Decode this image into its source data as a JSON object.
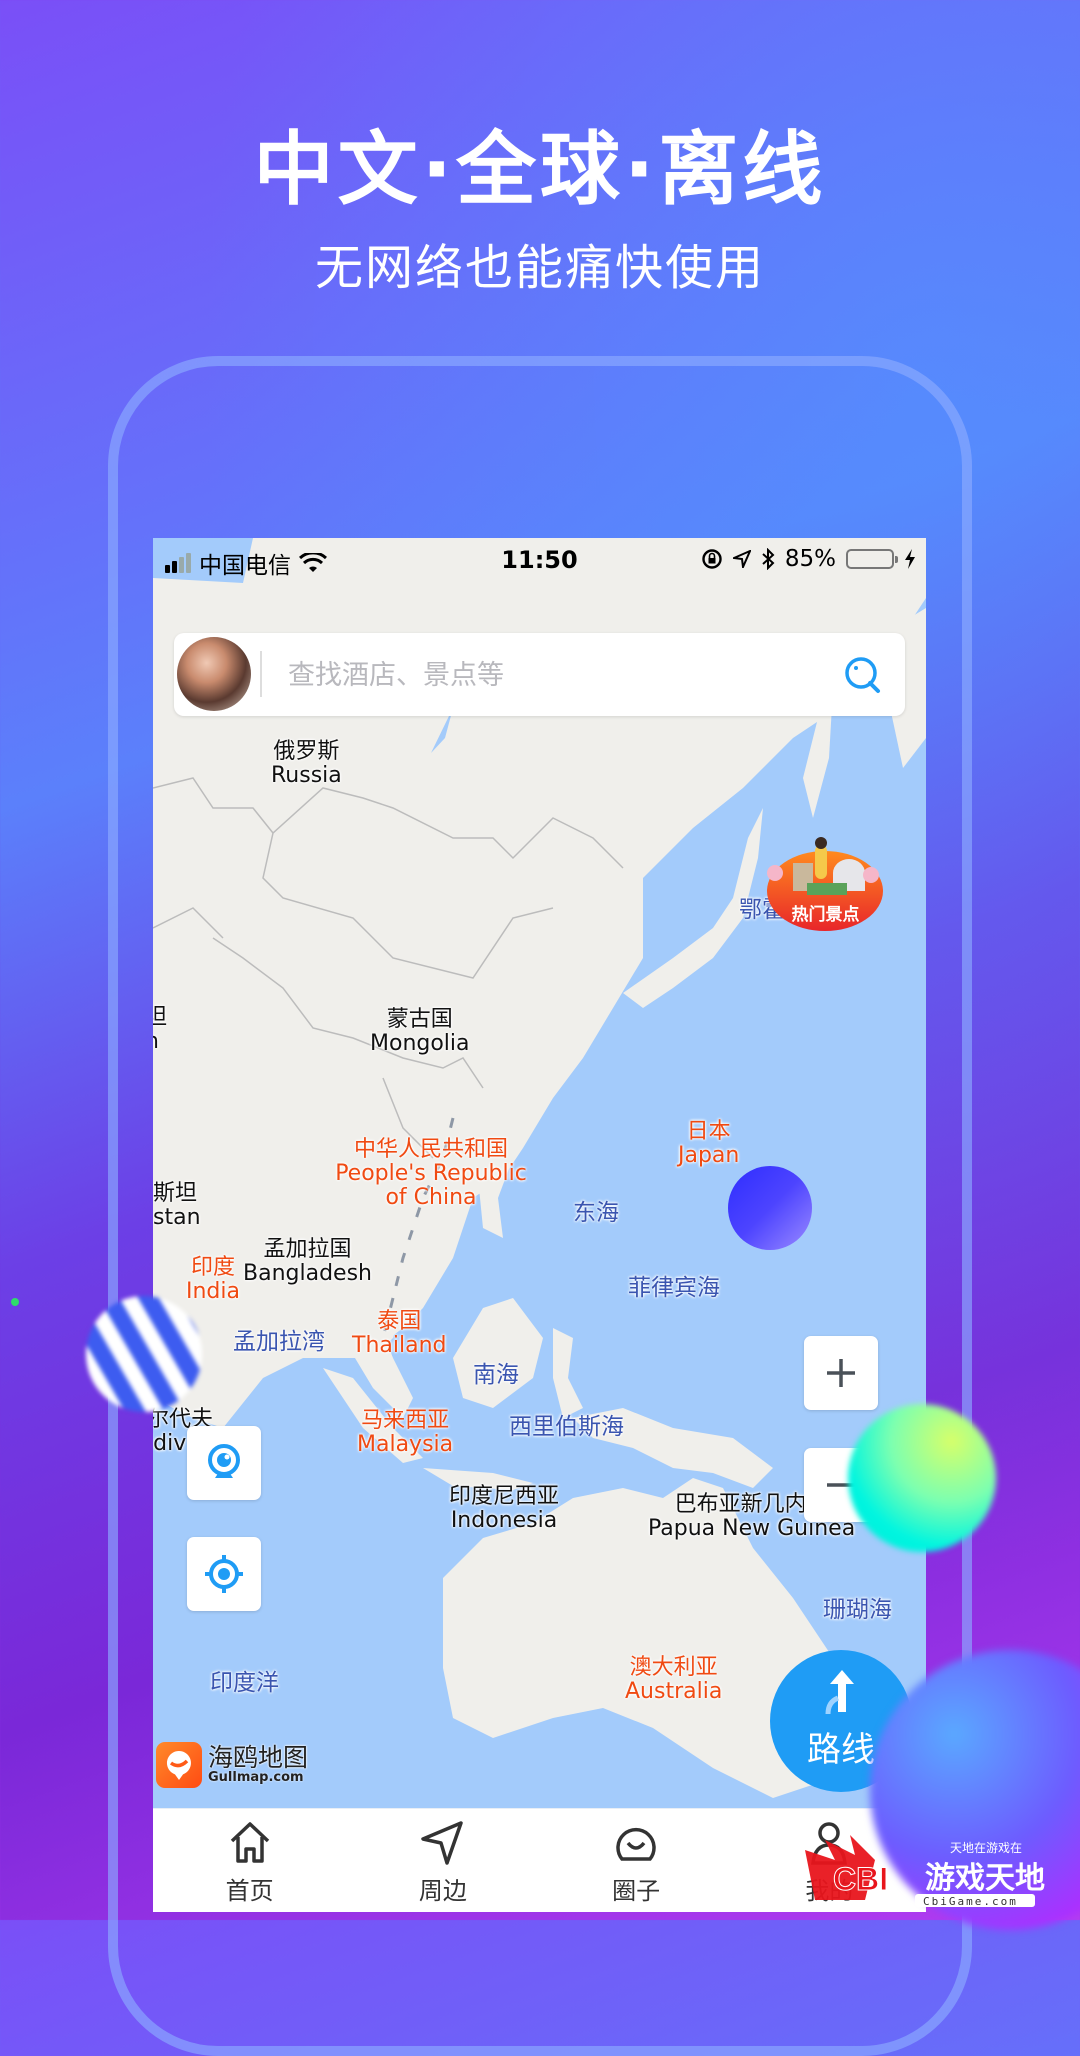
{
  "promo": {
    "headline": "中文·全球·离线",
    "subtitle": "无网络也能痛快使用"
  },
  "status_bar": {
    "carrier": "中国电信",
    "time": "11:50",
    "battery_percent": "85%",
    "battery_level": 0.85,
    "icons": [
      "signal-icon",
      "wifi-icon",
      "rotation-lock-icon",
      "location-arrow-icon",
      "bluetooth-icon",
      "battery-icon",
      "charging-icon"
    ]
  },
  "search": {
    "placeholder": "查找酒店、景点等",
    "value": ""
  },
  "map": {
    "labels": [
      {
        "cn": "俄罗斯",
        "en": "Russia",
        "type": "country"
      },
      {
        "cn": "蒙古国",
        "en": "Mongolia",
        "type": "country"
      },
      {
        "cn": "中华人民共和国",
        "en": "People's Republic of China",
        "type": "country-highlight"
      },
      {
        "cn": "日本",
        "en": "Japan",
        "type": "country-highlight"
      },
      {
        "cn": "印度",
        "en": "India",
        "type": "country-highlight"
      },
      {
        "cn": "孟加拉国",
        "en": "Bangladesh",
        "type": "country"
      },
      {
        "cn": "泰国",
        "en": "Thailand",
        "type": "country-highlight"
      },
      {
        "cn": "马来西亚",
        "en": "Malaysia",
        "type": "country-highlight"
      },
      {
        "cn": "印度尼西亚",
        "en": "Indonesia",
        "type": "country"
      },
      {
        "cn": "巴布亚新几内亚",
        "en": "Papua New Guinea",
        "type": "country"
      },
      {
        "cn": "澳大利亚",
        "en": "Australia",
        "type": "country-highlight"
      },
      {
        "cn": "斯坦",
        "en": "stan",
        "type": "country-partial"
      },
      {
        "cn": "坦",
        "en": "n",
        "type": "country-partial"
      },
      {
        "cn": "尔代夫",
        "en": "ldiv",
        "type": "country-partial"
      }
    ],
    "seas": [
      "东海",
      "菲律宾海",
      "南海",
      "西里伯斯海",
      "孟加拉湾",
      "珊瑚海",
      "印度洋",
      "鄂霍"
    ],
    "hot_spots_label": "热门景点",
    "zoom_in_label": "+",
    "zoom_out_label": "−",
    "route_label": "路线",
    "brand_name": "海鸥地图",
    "brand_domain": "Gullmap.com"
  },
  "tabs": [
    {
      "label": "首页",
      "icon": "home-icon"
    },
    {
      "label": "周边",
      "icon": "send-icon"
    },
    {
      "label": "圈子",
      "icon": "chat-circle-icon"
    },
    {
      "label": "我的",
      "icon": "user-icon"
    }
  ],
  "watermark": {
    "brand": "CBI",
    "name": "游戏天地",
    "tagline": "天地在游戏在",
    "domain": "CbiGame.com"
  },
  "colors": {
    "accent_blue": "#1f9cf5",
    "highlight_label": "#f04a12",
    "sea_label": "#3a55b0",
    "water": "#a3cbfb",
    "land": "#f0efeb"
  }
}
